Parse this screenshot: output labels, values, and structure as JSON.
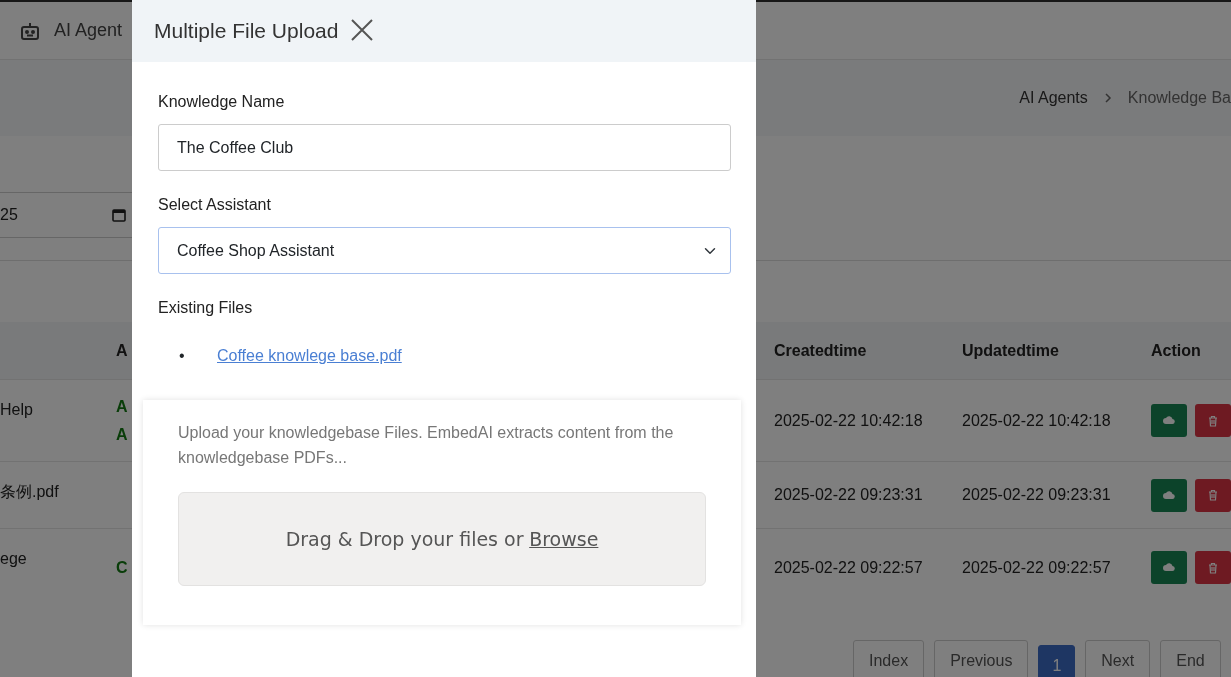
{
  "navbar": {
    "title": "AI Agent"
  },
  "breadcrumb": [
    {
      "label": "AI Agents"
    },
    {
      "label": "Knowledge Ba"
    }
  ],
  "date_filter": {
    "value": "25"
  },
  "table": {
    "columns": [
      "A",
      "Createdtime",
      "Updatedtime",
      "Action"
    ],
    "rows": [
      {
        "column_1": "Help",
        "column_2": [
          "A",
          "A"
        ],
        "created": "2025-02-22 10:42:18",
        "updated": "2025-02-22 10:42:18"
      },
      {
        "column_1": "条例.pdf",
        "column_2": [],
        "created": "2025-02-22 09:23:31",
        "updated": "2025-02-22 09:23:31"
      },
      {
        "column_1": "ege",
        "column_2": [
          "C"
        ],
        "created": "2025-02-22 09:22:57",
        "updated": "2025-02-22 09:22:57"
      }
    ]
  },
  "pagination": [
    {
      "label": "Index",
      "selected": false
    },
    {
      "label": "Previous",
      "selected": false
    },
    {
      "label": "1",
      "selected": true
    },
    {
      "label": "Next",
      "selected": false
    },
    {
      "label": "End",
      "selected": false
    }
  ],
  "modal": {
    "title": "Multiple File Upload",
    "knowledge_name": {
      "label": "Knowledge Name",
      "value": "The Coffee Club"
    },
    "assistant": {
      "label": "Select Assistant",
      "value": "Coffee Shop Assistant",
      "focused": true
    },
    "existing_files": {
      "label": "Existing Files",
      "files": [
        {
          "bullet": "•",
          "name": "Coffee knowlege base.pdf"
        }
      ]
    },
    "upload": {
      "hint": "Upload your knowledgebase Files. EmbedAI extracts content from the knowledgebase PDFs...",
      "dropzone_text": "Drag & Drop your files or",
      "browse": "Browse"
    }
  }
}
